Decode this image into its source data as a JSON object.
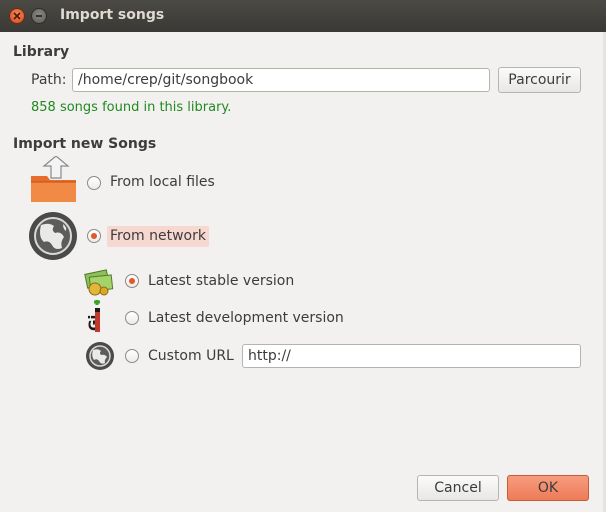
{
  "window": {
    "title": "Import songs"
  },
  "library": {
    "heading": "Library",
    "path_label": "Path:",
    "path_value": "/home/crep/git/songbook",
    "browse_label": "Parcourir",
    "status": "858 songs found in this library."
  },
  "import": {
    "heading": "Import new Songs",
    "local_files_label": "From local files",
    "network_label": "From network",
    "selected": "From network",
    "network": {
      "selected": "Latest stable version",
      "stable_label": "Latest stable version",
      "dev_label": "Latest development version",
      "custom_label": "Custom URL",
      "custom_value": "http://"
    }
  },
  "buttons": {
    "cancel": "Cancel",
    "ok": "OK"
  },
  "colors": {
    "accent": "#e0582b",
    "status_green": "#218a21",
    "titlebar": "#3c3b37"
  },
  "icons": [
    "close-icon",
    "minimize-icon",
    "folder-upload-icon",
    "globe-icon",
    "money-icon",
    "git-icon",
    "globe-small-icon"
  ]
}
